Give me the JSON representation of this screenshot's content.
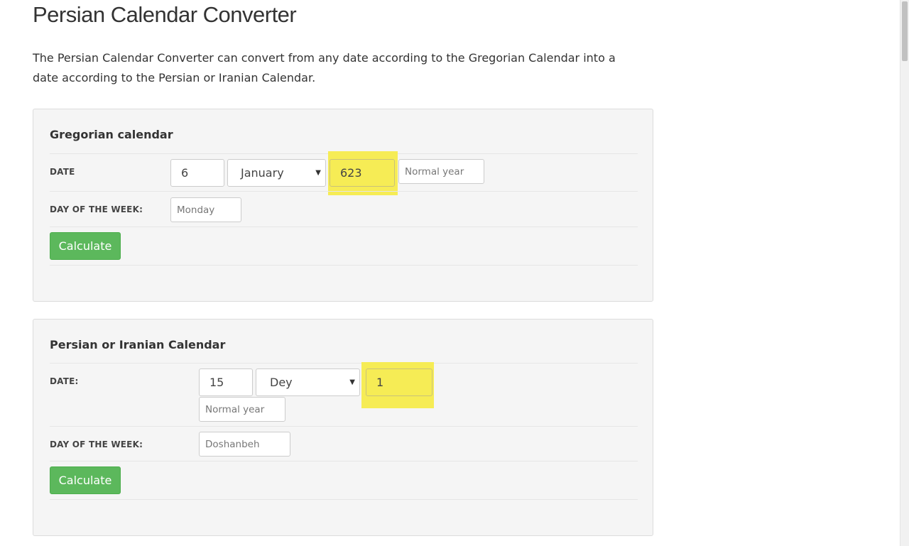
{
  "page": {
    "title": "Persian Calendar Converter",
    "intro": "The Persian Calendar Converter can convert from any date according to the Gregorian Calendar into a date according to the Persian or Iranian Calendar."
  },
  "gregorian": {
    "title": "Gregorian calendar",
    "date_label": "DATE",
    "day": "6",
    "month": "January",
    "year": "623",
    "year_type_placeholder": "Normal year",
    "weekday_label": "DAY OF THE WEEK:",
    "weekday_placeholder": "Monday",
    "calculate_label": "Calculate"
  },
  "persian": {
    "title": "Persian or Iranian Calendar",
    "date_label": "DATE:",
    "day": "15",
    "month": "Dey",
    "year": "1",
    "year_type_placeholder": "Normal year",
    "weekday_label": "DAY OF THE WEEK:",
    "weekday_placeholder": "Doshanbeh",
    "calculate_label": "Calculate"
  },
  "colors": {
    "highlight": "#f6ec55",
    "button": "#5cb85c",
    "panel": "#f5f5f5"
  },
  "icons": {
    "select_arrow": "triangle-down-icon"
  }
}
